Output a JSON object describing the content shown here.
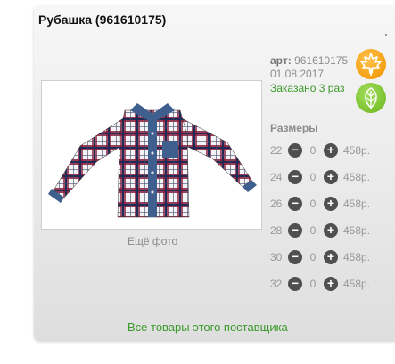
{
  "product": {
    "title": "Рубашка (961610175)",
    "art_label": "арт:",
    "art_value": "961610175",
    "date": "01.08.2017",
    "ordered": "Заказано 3 раз",
    "more_photo": "Ещё фото",
    "sizes_title": "Размеры",
    "supplier_link": "Все товары этого поставщика"
  },
  "badges": {
    "orange_icon": "maple-leaf-icon",
    "green_icon": "leaf-icon",
    "orange_color": "#f5a011",
    "green_color": "#7cc230"
  },
  "sizes": [
    {
      "size": "22",
      "qty": "0",
      "price": "458р."
    },
    {
      "size": "24",
      "qty": "0",
      "price": "458р."
    },
    {
      "size": "26",
      "qty": "0",
      "price": "458р."
    },
    {
      "size": "28",
      "qty": "0",
      "price": "458р."
    },
    {
      "size": "30",
      "qty": "0",
      "price": "458р."
    },
    {
      "size": "32",
      "qty": "0",
      "price": "458р."
    }
  ],
  "buttons": {
    "minus": "−",
    "plus": "+"
  }
}
